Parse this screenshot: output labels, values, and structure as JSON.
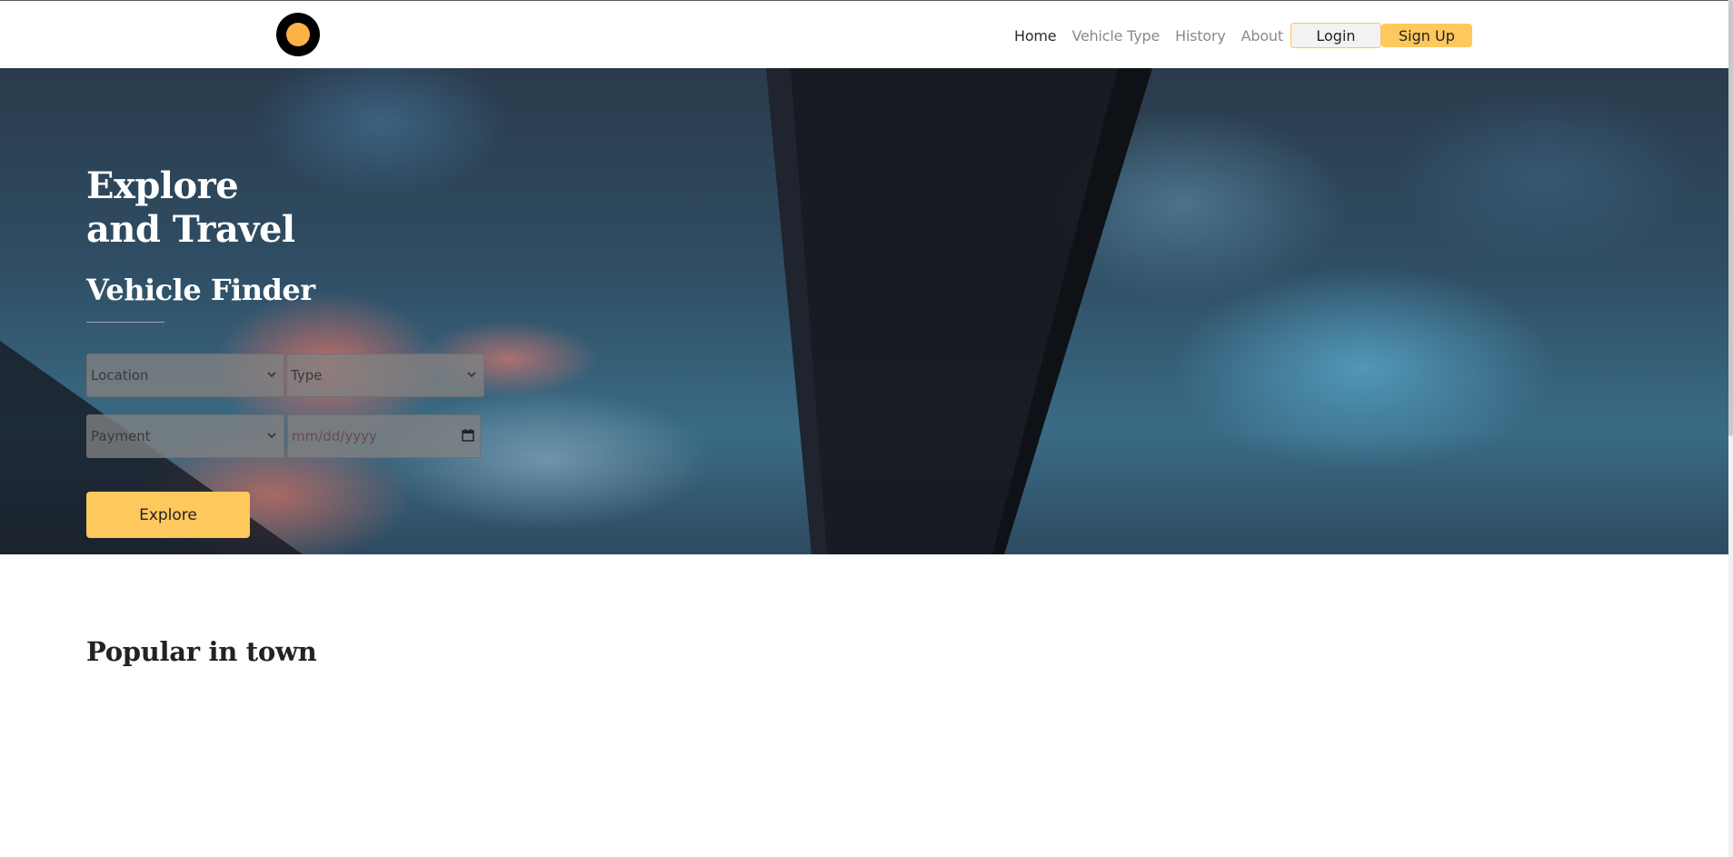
{
  "header": {
    "nav": [
      {
        "label": "Home",
        "active": true
      },
      {
        "label": "Vehicle Type",
        "active": false
      },
      {
        "label": "History",
        "active": false
      },
      {
        "label": "About",
        "active": false
      }
    ],
    "login_label": "Login",
    "signup_label": "Sign Up"
  },
  "hero": {
    "title_line1": "Explore",
    "title_line2": "and Travel",
    "finder_title": "Vehicle Finder",
    "fields": {
      "location": "Location",
      "type": "Type",
      "payment": "Payment",
      "date_placeholder": "mm/dd/yyyy"
    },
    "explore_label": "Explore"
  },
  "popular": {
    "title": "Popular in town"
  },
  "colors": {
    "accent": "#fdc85c",
    "logo_outer": "#000000",
    "logo_inner": "#fdb147"
  },
  "icons": {
    "logo": "circle-logo-icon",
    "select": "chevron-down-icon",
    "date": "calendar-icon"
  }
}
